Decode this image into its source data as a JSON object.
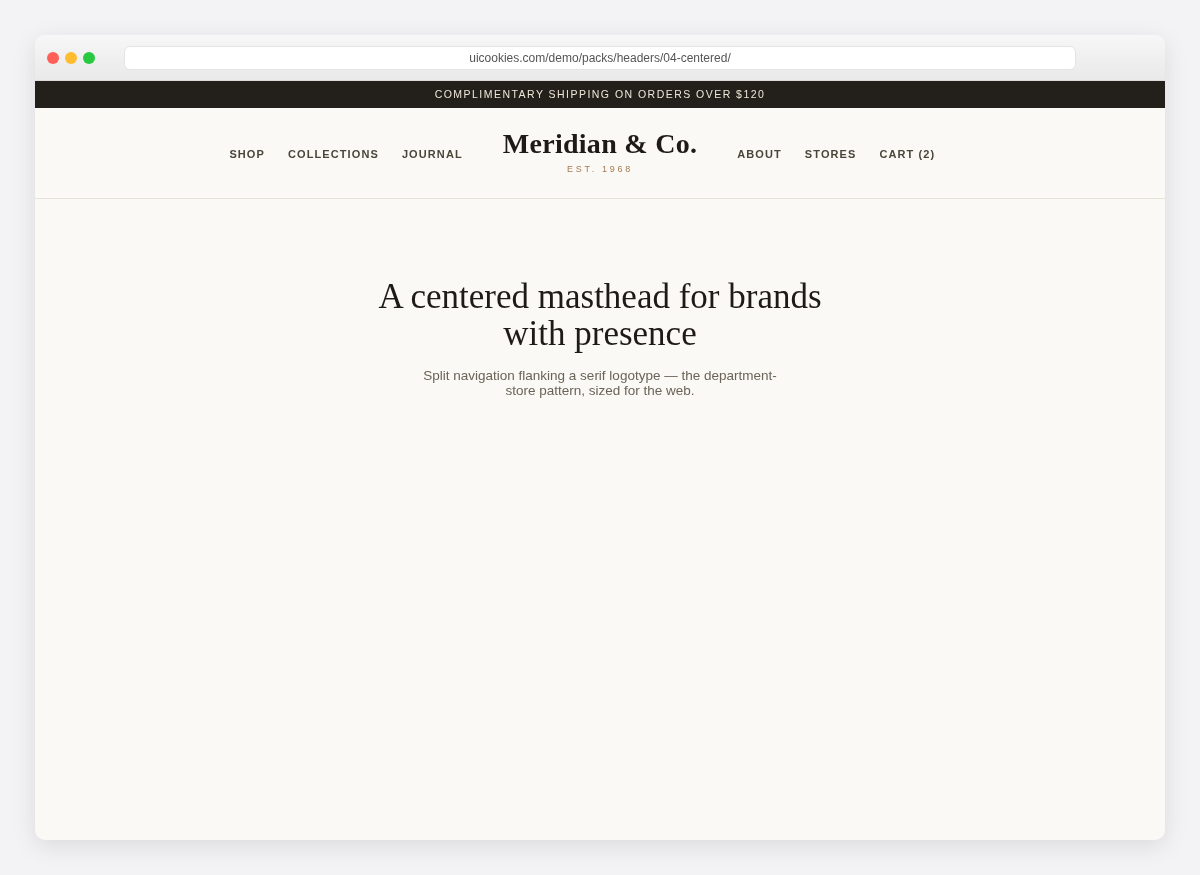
{
  "browser": {
    "address": "uicookies.com/demo/packs/headers/04-centered/"
  },
  "announcement": "COMPLIMENTARY SHIPPING ON ORDERS OVER $120",
  "header": {
    "nav_left": [
      {
        "label": "SHOP"
      },
      {
        "label": "COLLECTIONS"
      },
      {
        "label": "JOURNAL"
      }
    ],
    "logo": {
      "name": "Meridian & Co.",
      "tagline": "EST. 1968"
    },
    "nav_right": [
      {
        "label": "ABOUT"
      },
      {
        "label": "STORES"
      },
      {
        "label": "CART (2)"
      }
    ]
  },
  "hero": {
    "title": "A centered masthead for brands with presence",
    "subtitle": "Split navigation flanking a serif logotype — the department-store pattern, sized for the web."
  }
}
